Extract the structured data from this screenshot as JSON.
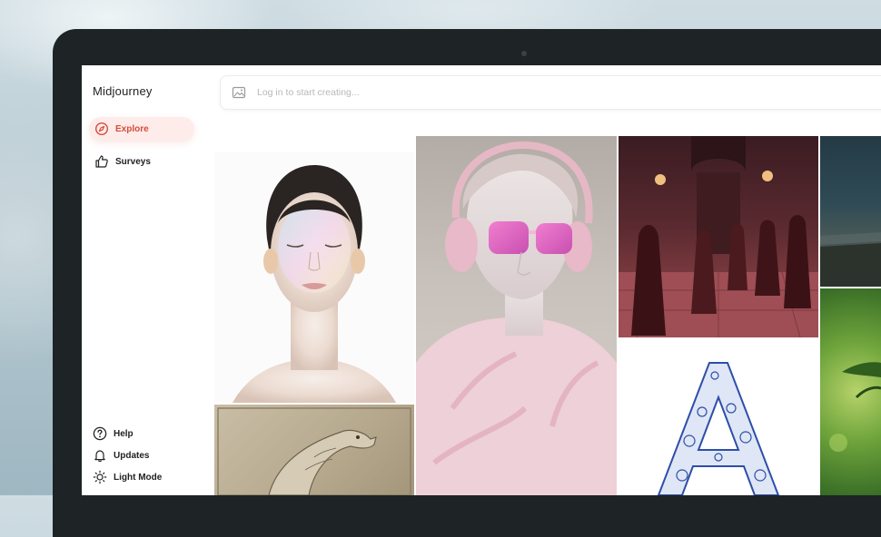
{
  "app": {
    "name": "Midjourney"
  },
  "search": {
    "placeholder": "Log in to start creating..."
  },
  "sidebar": {
    "items": [
      {
        "label": "Explore",
        "icon": "compass-icon",
        "active": true
      },
      {
        "label": "Surveys",
        "icon": "thumbs-up-icon",
        "active": false
      }
    ],
    "footer": [
      {
        "label": "Help",
        "icon": "help-circle-icon"
      },
      {
        "label": "Updates",
        "icon": "bell-icon"
      },
      {
        "label": "Light Mode",
        "icon": "sun-icon"
      }
    ]
  },
  "gallery": {
    "tiles": [
      "portrait-image",
      "statue-headphones-image",
      "cloaked-figures-image",
      "landscape-image",
      "sketch-creature-image",
      "floral-letter-a-image",
      "leaves-image"
    ]
  },
  "colors": {
    "accent": "#d84a38",
    "accent_bg": "#fdecea"
  }
}
